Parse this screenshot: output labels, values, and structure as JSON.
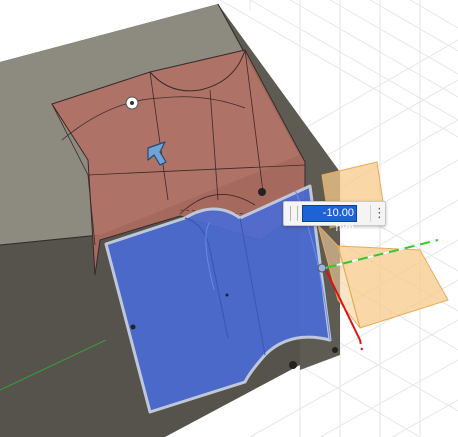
{
  "dimension_input": {
    "value": "-10.00 mm"
  },
  "icons": {
    "options": "more-options-icon",
    "cursor": "cursor-arrow-icon"
  },
  "colors": {
    "selected_face": "#4a6bd6",
    "highlighted_body": "#b46d62",
    "body_dark": "#56534c",
    "body_top": "#8d8a80",
    "preview_plane": "#f7c98a",
    "axis_x": "#e11010",
    "axis_y": "#2ecb2e",
    "grid": "#e3e3e3"
  }
}
